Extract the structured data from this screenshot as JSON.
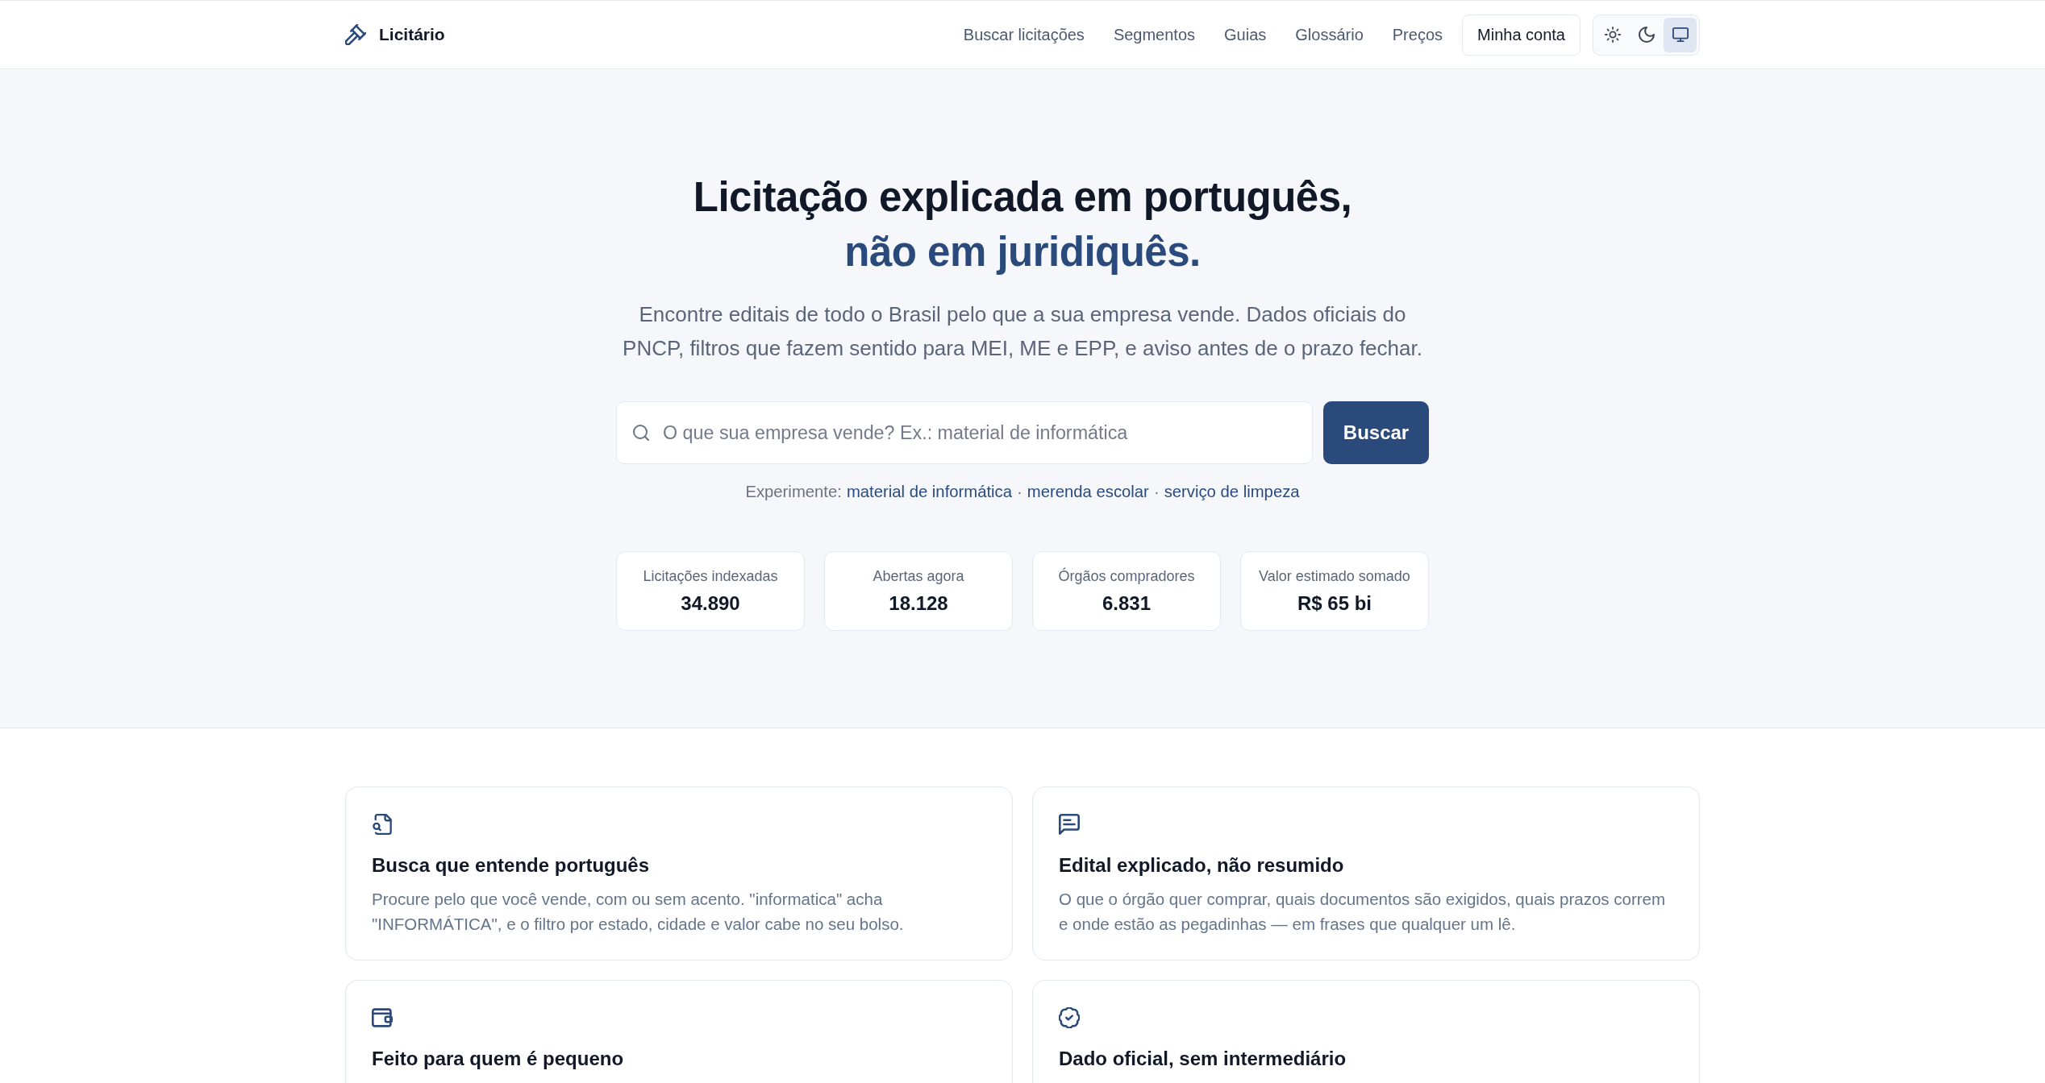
{
  "header": {
    "logo": "Licitário",
    "nav": [
      {
        "label": "Buscar licitações"
      },
      {
        "label": "Segmentos"
      },
      {
        "label": "Guias"
      },
      {
        "label": "Glossário"
      },
      {
        "label": "Preços"
      }
    ],
    "account_button": "Minha conta",
    "theme_toggle": [
      {
        "kind": "light",
        "selected": false
      },
      {
        "kind": "dark",
        "selected": false
      },
      {
        "kind": "system",
        "selected": true
      }
    ]
  },
  "hero": {
    "title": "Licitação explicada em português,",
    "title_highlight": "não em juridiquês.",
    "subtitle": "Encontre editais de todo o Brasil pelo que a sua empresa vende. Dados oficiais do PNCP, filtros que fazem sentido para MEI, ME e EPP, e aviso antes de o prazo fechar.",
    "search": {
      "placeholder": "O que sua empresa vende? Ex.: material de informática",
      "button": "Buscar"
    },
    "suggestions": {
      "label": "Experimente:",
      "items": [
        {
          "kind": "link",
          "text": "material de informática"
        },
        {
          "kind": "separator",
          "text": "·"
        },
        {
          "kind": "link",
          "text": "merenda escolar"
        },
        {
          "kind": "separator",
          "text": "·"
        },
        {
          "kind": "link",
          "text": "serviço de limpeza"
        }
      ]
    },
    "stats": [
      {
        "label": "Licitações indexadas",
        "value": "34.890"
      },
      {
        "label": "Abertas agora",
        "value": "18.128"
      },
      {
        "label": "Órgãos compradores",
        "value": "6.831"
      },
      {
        "label": "Valor estimado somado",
        "value": "R$ 65 bi"
      }
    ]
  },
  "features": [
    {
      "kind": "document",
      "title": "Busca que entende português",
      "description": "Procure pelo que você vende, com ou sem acento. \"informatica\" acha \"INFORMÁTICA\", e o filtro por estado, cidade e valor cabe no seu bolso."
    },
    {
      "kind": "message",
      "title": "Edital explicado, não resumido",
      "description": "O que o órgão quer comprar, quais documentos são exigidos, quais prazos correm e onde estão as pegadinhas — em frases que qualquer um lê."
    },
    {
      "kind": "wallet",
      "title": "Feito para quem é pequeno"
    },
    {
      "kind": "badge",
      "title": "Dado oficial, sem intermediário"
    }
  ]
}
